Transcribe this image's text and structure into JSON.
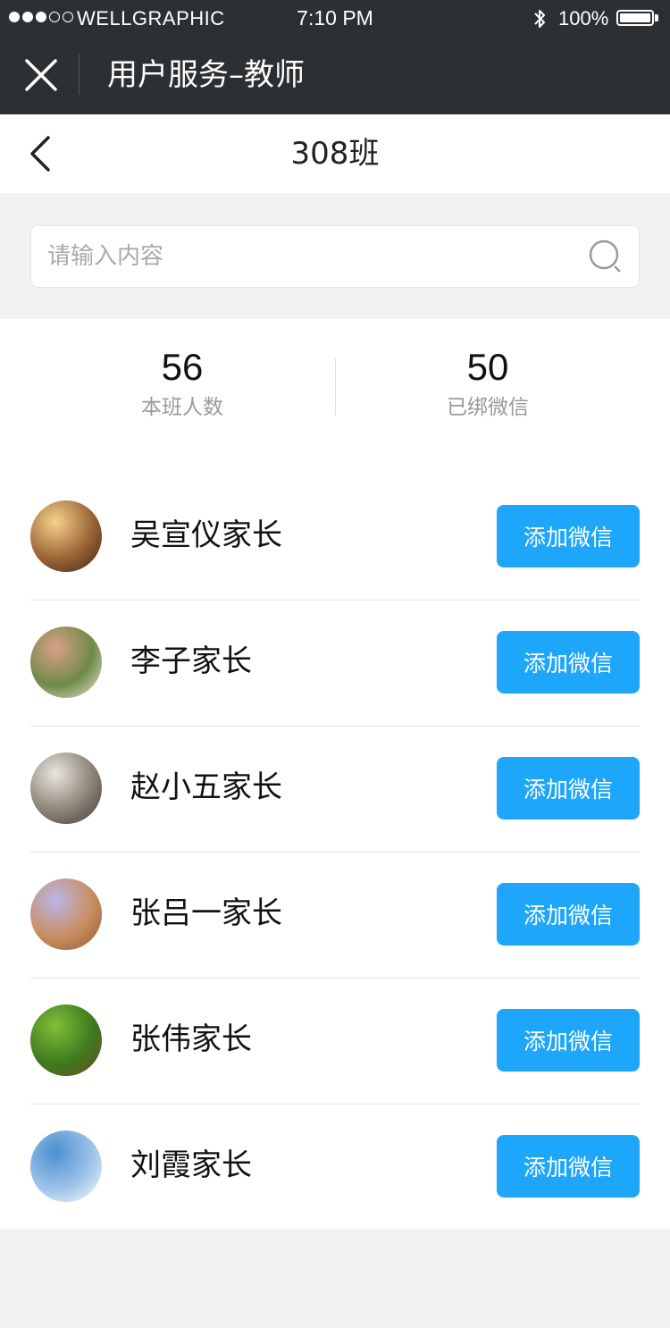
{
  "status_bar": {
    "carrier": "WELLGRAPHIC",
    "time": "7:10 PM",
    "battery": "100%",
    "signal_bars_filled": 3,
    "signal_bars_total": 5,
    "battery_level": 1.0
  },
  "nav": {
    "title": "用户服务–教师",
    "close_icon": "close-icon"
  },
  "sub_header": {
    "title": "308班",
    "back_icon": "chevron-left-icon"
  },
  "search": {
    "placeholder": "请输入内容",
    "value": "",
    "icon": "search-icon"
  },
  "stats": {
    "total_count": "56",
    "total_label": "本班人数",
    "bound_count": "50",
    "bound_label": "已绑微信"
  },
  "parents": [
    {
      "name": "吴宣仪家长",
      "button": "添加微信",
      "avatar_colors": [
        "#f7d18a",
        "#9a6336",
        "#3b2415"
      ]
    },
    {
      "name": "李子家长",
      "button": "添加微信",
      "avatar_colors": [
        "#d9a089",
        "#6f8a47",
        "#f2e6de"
      ]
    },
    {
      "name": "赵小五家长",
      "button": "添加微信",
      "avatar_colors": [
        "#e9e6df",
        "#8c8275",
        "#3f3a34"
      ]
    },
    {
      "name": "张吕一家长",
      "button": "添加微信",
      "avatar_colors": [
        "#b9b6ea",
        "#c98e5f",
        "#8a5a35"
      ]
    },
    {
      "name": "张伟家长",
      "button": "添加微信",
      "avatar_colors": [
        "#7fbf3a",
        "#3f7a1e",
        "#6a4b22"
      ]
    },
    {
      "name": "刘霞家长",
      "button": "添加微信",
      "avatar_colors": [
        "#4e8fd0",
        "#9dc3ea",
        "#ffffff"
      ]
    }
  ],
  "colors": {
    "nav_bg": "#2d3033",
    "accent": "#1ea6fb",
    "page_bg": "#f2f2f2"
  }
}
